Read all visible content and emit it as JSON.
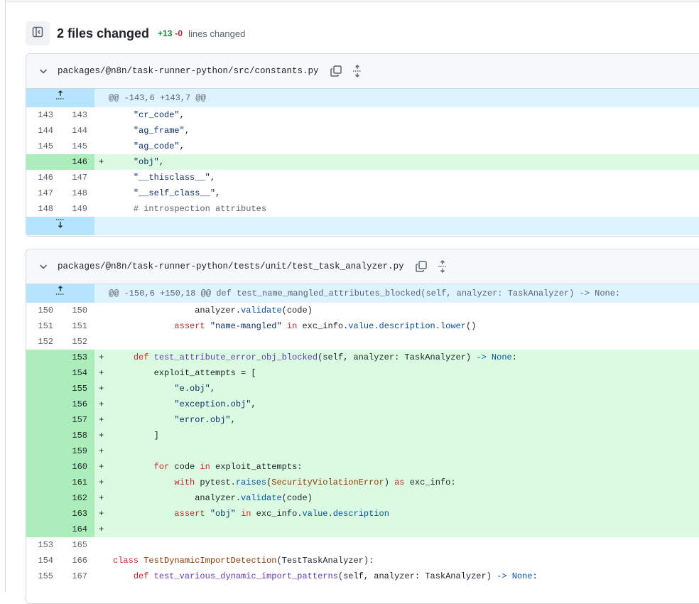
{
  "summary": {
    "files_changed": "2 files changed",
    "additions": "+13",
    "deletions": "-0",
    "lines_label": "lines changed"
  },
  "files": [
    {
      "path": "packages/@n8n/task-runner-python/src/constants.py",
      "hunk": "@@ -143,6 +143,7 @@",
      "lines": [
        {
          "old": "143",
          "new": "143",
          "sign": "",
          "code": "    \"cr_code\","
        },
        {
          "old": "144",
          "new": "144",
          "sign": "",
          "code": "    \"ag_frame\","
        },
        {
          "old": "145",
          "new": "145",
          "sign": "",
          "code": "    \"ag_code\","
        },
        {
          "old": "",
          "new": "146",
          "sign": "+",
          "code": "    \"obj\","
        },
        {
          "old": "146",
          "new": "147",
          "sign": "",
          "code": "    \"__thisclass__\","
        },
        {
          "old": "147",
          "new": "148",
          "sign": "",
          "code": "    \"__self_class__\","
        },
        {
          "old": "148",
          "new": "149",
          "sign": "",
          "code": "    # introspection attributes"
        }
      ]
    },
    {
      "path": "packages/@n8n/task-runner-python/tests/unit/test_task_analyzer.py",
      "hunk": "@@ -150,6 +150,18 @@ def test_name_mangled_attributes_blocked(self, analyzer: TaskAnalyzer) -> None:",
      "lines": [
        {
          "old": "150",
          "new": "150",
          "sign": "",
          "code": "                analyzer.validate(code)"
        },
        {
          "old": "151",
          "new": "151",
          "sign": "",
          "code": "            assert \"name-mangled\" in exc_info.value.description.lower()"
        },
        {
          "old": "152",
          "new": "152",
          "sign": "",
          "code": ""
        },
        {
          "old": "",
          "new": "153",
          "sign": "+",
          "code": "    def test_attribute_error_obj_blocked(self, analyzer: TaskAnalyzer) -> None:"
        },
        {
          "old": "",
          "new": "154",
          "sign": "+",
          "code": "        exploit_attempts = ["
        },
        {
          "old": "",
          "new": "155",
          "sign": "+",
          "code": "            \"e.obj\","
        },
        {
          "old": "",
          "new": "156",
          "sign": "+",
          "code": "            \"exception.obj\","
        },
        {
          "old": "",
          "new": "157",
          "sign": "+",
          "code": "            \"error.obj\","
        },
        {
          "old": "",
          "new": "158",
          "sign": "+",
          "code": "        ]"
        },
        {
          "old": "",
          "new": "159",
          "sign": "+",
          "code": ""
        },
        {
          "old": "",
          "new": "160",
          "sign": "+",
          "code": "        for code in exploit_attempts:"
        },
        {
          "old": "",
          "new": "161",
          "sign": "+",
          "code": "            with pytest.raises(SecurityViolationError) as exc_info:"
        },
        {
          "old": "",
          "new": "162",
          "sign": "+",
          "code": "                analyzer.validate(code)"
        },
        {
          "old": "",
          "new": "163",
          "sign": "+",
          "code": "            assert \"obj\" in exc_info.value.description"
        },
        {
          "old": "",
          "new": "164",
          "sign": "+",
          "code": ""
        },
        {
          "old": "153",
          "new": "165",
          "sign": "",
          "code": ""
        },
        {
          "old": "154",
          "new": "166",
          "sign": "",
          "code": "class TestDynamicImportDetection(TestTaskAnalyzer):"
        },
        {
          "old": "155",
          "new": "167",
          "sign": "",
          "code": "    def test_various_dynamic_import_patterns(self, analyzer: TaskAnalyzer) -> None:"
        }
      ]
    }
  ],
  "icons": {
    "sidebar_toggle": "sidebar-toggle-icon",
    "chevron": "chevron-down-icon",
    "copy": "copy-icon",
    "expand": "unfold-icon",
    "expand_up": "expand-up-icon",
    "expand_down": "expand-down-icon"
  },
  "colors": {
    "addition_row": "#dafbe1",
    "addition_gutter": "#aceebb",
    "hunk_row": "#ddf4ff",
    "hunk_expand": "#b6e3ff",
    "additions_text": "#1a7f37",
    "deletions_text": "#cf222e"
  }
}
